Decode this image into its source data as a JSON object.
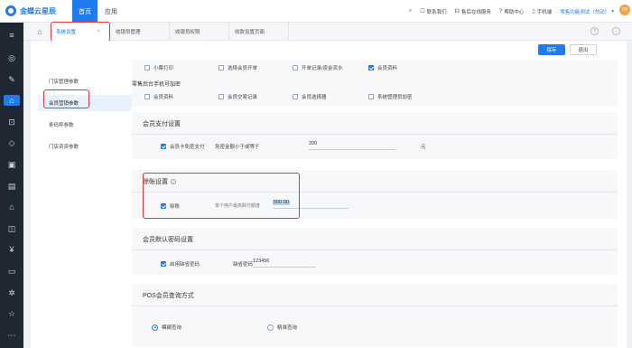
{
  "topbar": {
    "logo_text": "金蝶云星辰",
    "nav_home": "首页",
    "nav_app": "应用",
    "search_icon": "search-icon",
    "contact_us": "联系我们",
    "online_service": "售后在线服务",
    "help_center": "帮助中心",
    "mobile": "手机端",
    "company": "零售功能测试（勿动）",
    "avatar_text": "SH"
  },
  "tabs": [
    {
      "label": "系统设置",
      "active": true,
      "close": "×"
    },
    {
      "label": "收银员管理",
      "active": false
    },
    {
      "label": "收银员权限",
      "active": false
    },
    {
      "label": "收款设置页面",
      "active": false
    }
  ],
  "actions": {
    "save": "保存",
    "exit": "退出"
  },
  "left_nav": [
    {
      "label": "门店管理参数",
      "active": false
    },
    {
      "label": "会员营销参数",
      "active": true
    },
    {
      "label": "条码秤参数",
      "active": false
    },
    {
      "label": "门店资资参数",
      "active": false
    }
  ],
  "top_section": {
    "row1": [
      {
        "label": "小票打印",
        "checked": false
      },
      {
        "label": "选择会员开单",
        "checked": false
      },
      {
        "label": "开单记录/资金流水",
        "checked": false
      },
      {
        "label": "会员资料",
        "checked": true
      }
    ],
    "subtitle": "零售后台手机号加密",
    "row2": [
      {
        "label": "会员资料",
        "checked": false
      },
      {
        "label": "会员交易记录",
        "checked": false
      },
      {
        "label": "会员选择器",
        "checked": false
      },
      {
        "label": "系统管理员加密",
        "checked": false
      }
    ]
  },
  "member_pay": {
    "title": "会员支付设置",
    "option": "会员卡免密支付",
    "checked": true,
    "threshold_label": "免密金额小于或等于",
    "threshold_value": "200",
    "unit": "元"
  },
  "credit": {
    "title": "赊账设置",
    "info": "?",
    "option": "赊账",
    "checked": true,
    "limit_label": "单个用户最高赊付额度",
    "limit_value": "500.00"
  },
  "password": {
    "title": "会员默认密码设置",
    "option": "启用缺省密码",
    "checked": true,
    "pwd_label": "缺省密码",
    "pwd_value": "123456"
  },
  "pos_query": {
    "title": "POS会员查询方式",
    "options": [
      {
        "label": "模糊查询",
        "selected": true
      },
      {
        "label": "精准查询",
        "selected": false
      }
    ]
  },
  "colors": {
    "accent": "#1e7cf0",
    "sidebar": "#1f2733",
    "highlight": "#e03a3a"
  }
}
